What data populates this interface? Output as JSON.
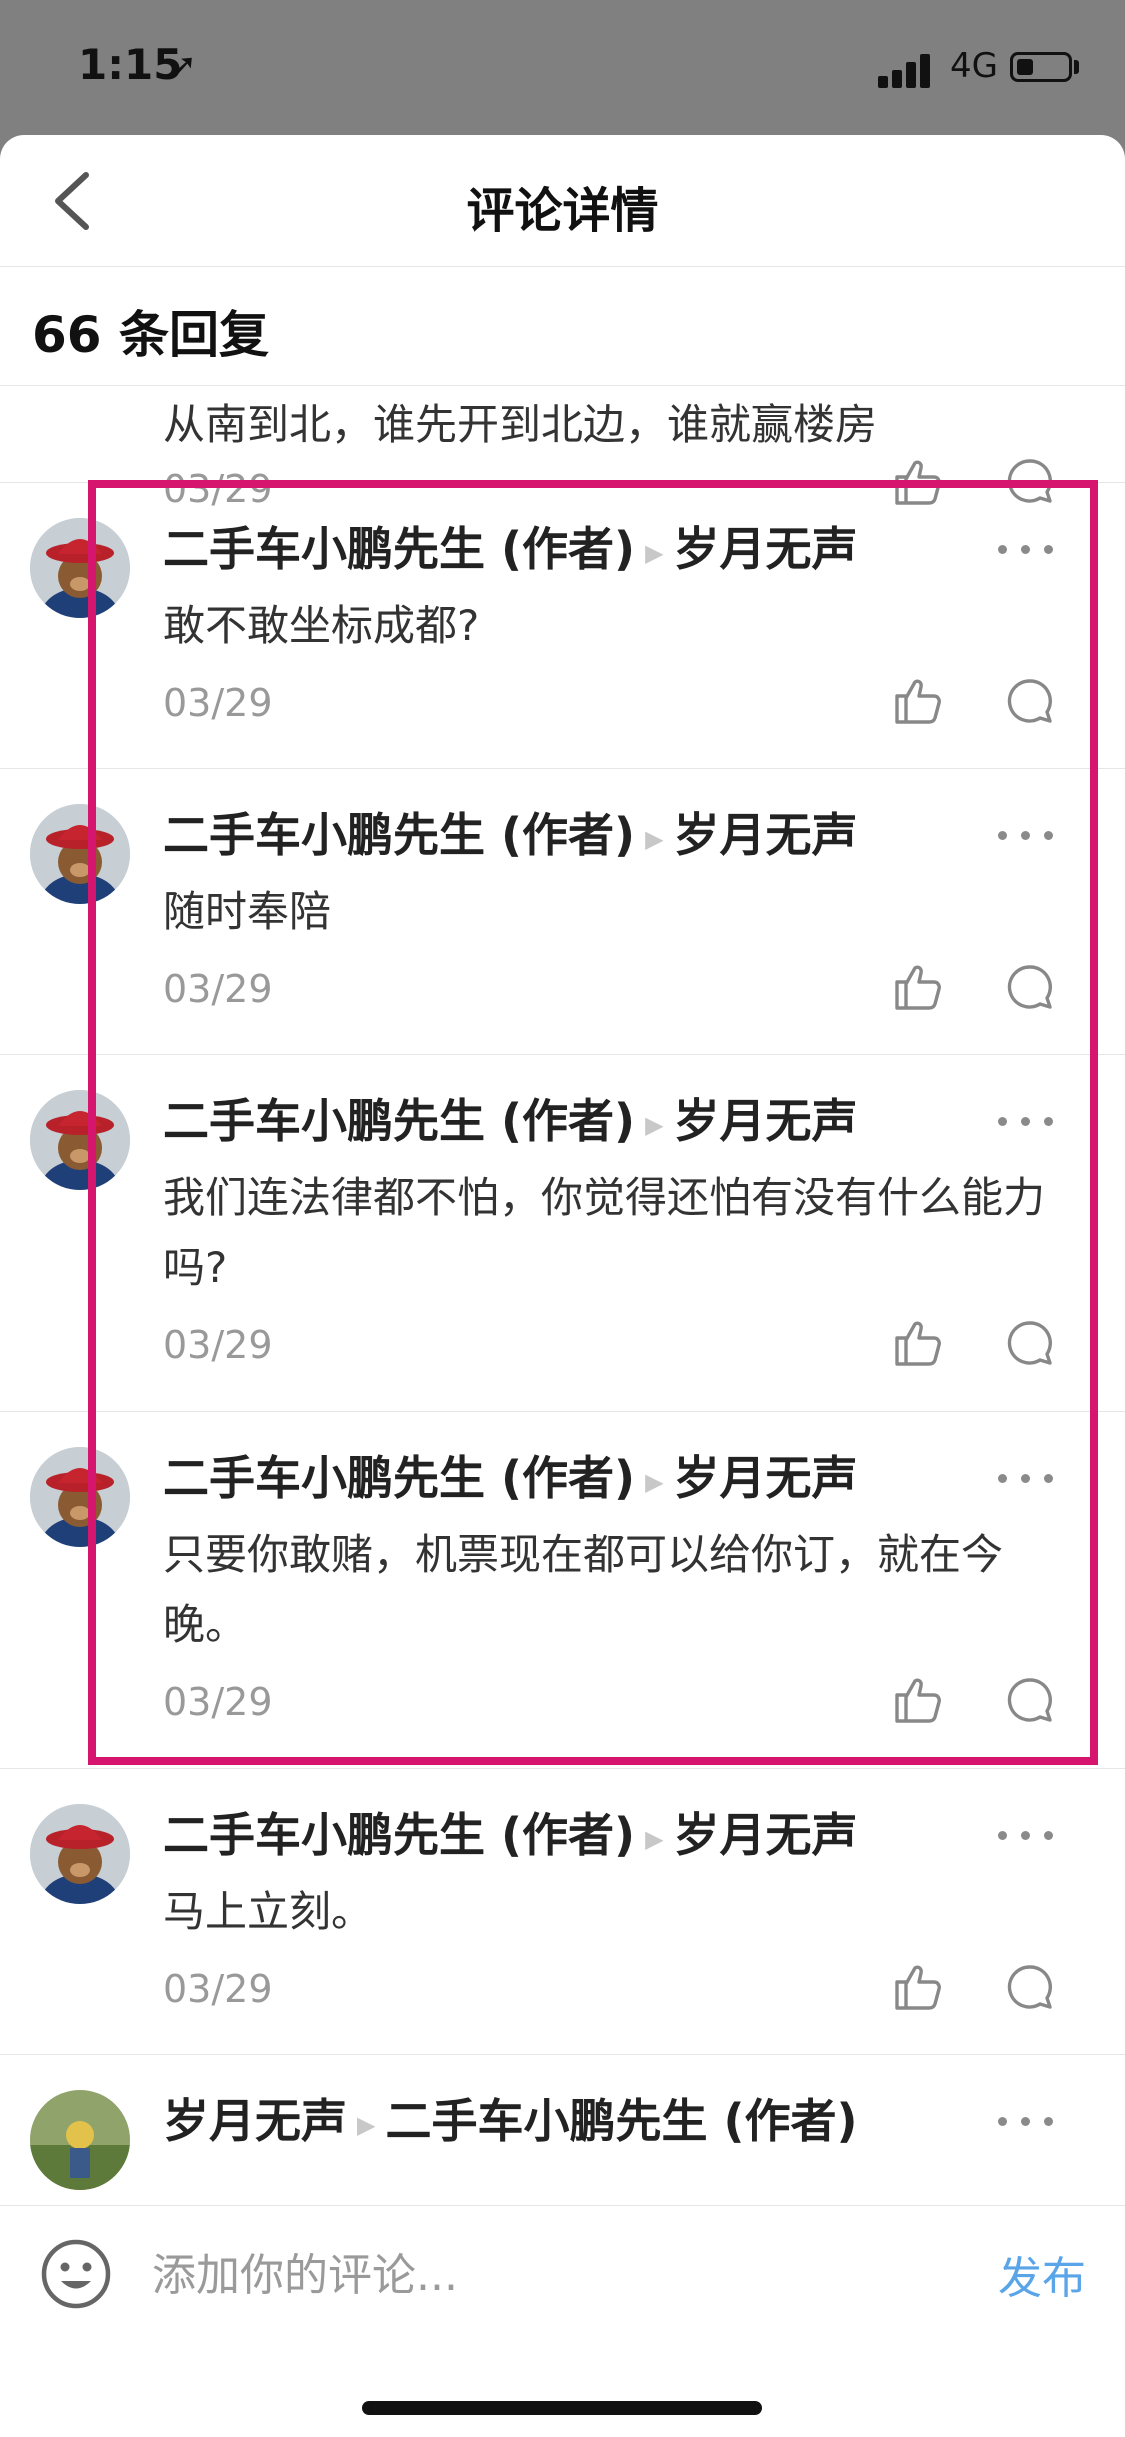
{
  "status_bar": {
    "time": "1:15",
    "network": "4G"
  },
  "header": {
    "title": "评论详情",
    "reply_count": "66 条回复"
  },
  "comments": [
    {
      "text": "从南到北，谁先开到北边，谁就赢楼房",
      "date": "03/29"
    },
    {
      "author": "二手车小鹏先生 (作者)",
      "target": "岁月无声",
      "text": "敢不敢坐标成都?",
      "date": "03/29"
    },
    {
      "author": "二手车小鹏先生 (作者)",
      "target": "岁月无声",
      "text": "随时奉陪",
      "date": "03/29"
    },
    {
      "author": "二手车小鹏先生 (作者)",
      "target": "岁月无声",
      "text": "我们连法律都不怕，你觉得还怕有没有什么能力吗?",
      "date": "03/29"
    },
    {
      "author": "二手车小鹏先生 (作者)",
      "target": "岁月无声",
      "text": "只要你敢赌，机票现在都可以给你订，就在今晚。",
      "date": "03/29"
    },
    {
      "author": "二手车小鹏先生 (作者)",
      "target": "岁月无声",
      "text": "马上立刻。",
      "date": "03/29"
    },
    {
      "author": "岁月无声",
      "target": "二手车小鹏先生 (作者)"
    }
  ],
  "composer": {
    "placeholder": "添加你的评论...",
    "publish_label": "发布"
  },
  "icons": {
    "back": "chevron-left-icon",
    "more": "more-icon",
    "like": "thumbs-up-icon",
    "reply": "speech-bubble-icon",
    "emoji": "smiley-icon",
    "location": "location-arrow-icon"
  },
  "colors": {
    "highlight": "#d6166e",
    "publish": "#5aa5e8",
    "status_bar": "#808080"
  }
}
